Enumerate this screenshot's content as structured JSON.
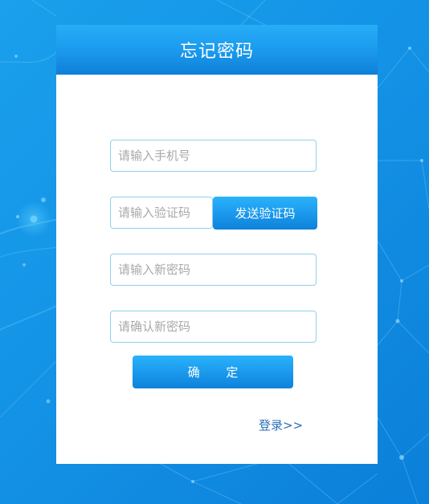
{
  "page": {
    "title": "忘记密码"
  },
  "form": {
    "phone_placeholder": "请输入手机号",
    "code_placeholder": "请输入验证码",
    "send_code_label": "发送验证码",
    "new_password_placeholder": "请输入新密码",
    "confirm_password_placeholder": "请确认新密码",
    "confirm_label": "确 定",
    "login_link": "登录>>"
  },
  "colors": {
    "accent": "#1a9bee",
    "background": "#1493e6",
    "input_border": "#8fd0ee",
    "link": "#2a6fb5"
  }
}
